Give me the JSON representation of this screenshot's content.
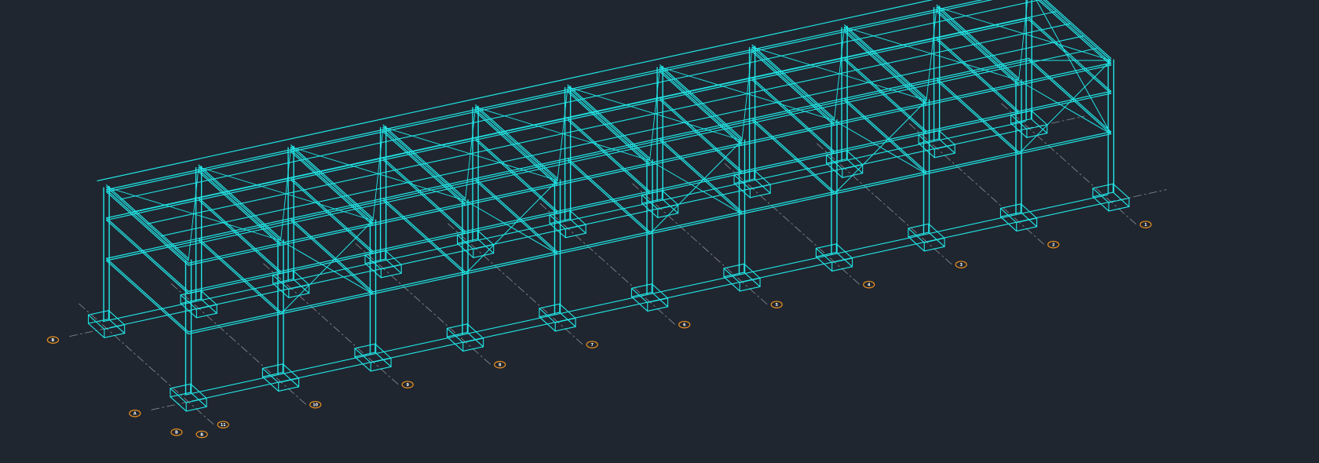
{
  "drawing": {
    "background_color": "#1f2630",
    "frame_color": "#21e6e6",
    "grid_line_color": "#8a8f96",
    "bubble_color": "#f0921e",
    "grid_bubbles": {
      "row_labels": [
        "A",
        "B",
        "B",
        "B"
      ],
      "column_labels": [
        "1",
        "2",
        "3",
        "4",
        "5",
        "6",
        "7",
        "8",
        "9",
        "10",
        "11"
      ]
    }
  }
}
